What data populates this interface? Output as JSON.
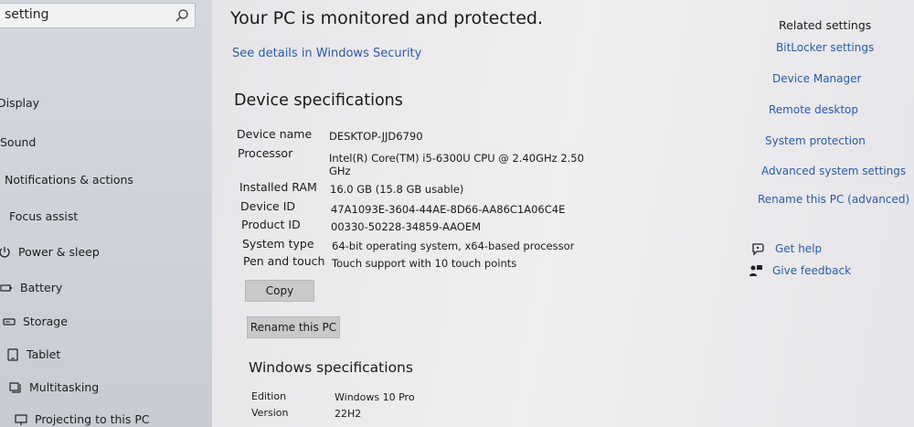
{
  "sidebar": {
    "search_value": "setting",
    "items": [
      {
        "label": "Display",
        "icon": "display-icon"
      },
      {
        "label": "Sound",
        "icon": "sound-icon"
      },
      {
        "label": "Notifications & actions",
        "icon": "notifications-icon"
      },
      {
        "label": "Focus assist",
        "icon": "focus-assist-icon"
      },
      {
        "label": "Power & sleep",
        "icon": "power-icon"
      },
      {
        "label": "Battery",
        "icon": "battery-icon"
      },
      {
        "label": "Storage",
        "icon": "storage-icon"
      },
      {
        "label": "Tablet",
        "icon": "tablet-icon"
      },
      {
        "label": "Multitasking",
        "icon": "multitasking-icon"
      },
      {
        "label": "Projecting to this PC",
        "icon": "projecting-icon"
      }
    ]
  },
  "main": {
    "protection_status": "Your PC is monitored and protected.",
    "security_link": "See details in Windows Security",
    "device_specs_title": "Device specifications",
    "device_specs": [
      {
        "label": "Device name",
        "value": "DESKTOP-JJD6790"
      },
      {
        "label": "Processor",
        "value": "Intel(R) Core(TM) i5-6300U CPU @ 2.40GHz   2.50",
        "value2": "GHz"
      },
      {
        "label": "Installed RAM",
        "value": "16.0 GB (15.8 GB usable)"
      },
      {
        "label": "Device ID",
        "value": "47A1093E-3604-44AE-8D66-AA86C1A06C4E"
      },
      {
        "label": "Product ID",
        "value": "00330-50228-34859-AAOEM"
      },
      {
        "label": "System type",
        "value": "64-bit operating system, x64-based processor"
      },
      {
        "label": "Pen and touch",
        "value": "Touch support with 10 touch points"
      }
    ],
    "copy_button": "Copy",
    "rename_button": "Rename this PC",
    "windows_specs_title": "Windows specifications",
    "windows_specs": [
      {
        "label": "Edition",
        "value": "Windows 10 Pro"
      },
      {
        "label": "Version",
        "value": "22H2"
      }
    ]
  },
  "related": {
    "title": "Related settings",
    "links": [
      "BitLocker settings",
      "Device Manager",
      "Remote desktop",
      "System protection",
      "Advanced system settings",
      "Rename this PC (advanced)"
    ],
    "get_help": "Get help",
    "give_feedback": "Give feedback"
  },
  "colors": {
    "link": "#2a5ba8",
    "sidebar_bg": "#cdd2d9",
    "button_bg": "#c9c9cc"
  }
}
